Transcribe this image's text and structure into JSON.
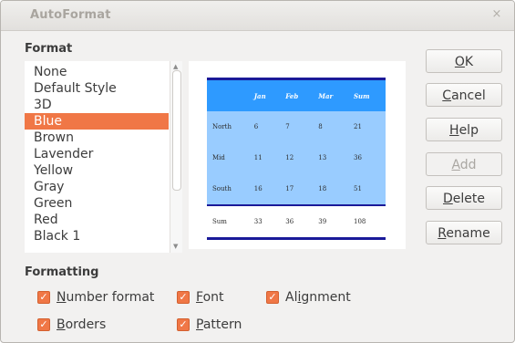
{
  "window": {
    "title": "AutoFormat",
    "close_icon": "close-icon"
  },
  "format": {
    "label": "Format",
    "items": [
      "None",
      "Default Style",
      "3D",
      "Blue",
      "Brown",
      "Lavender",
      "Yellow",
      "Gray",
      "Green",
      "Red",
      "Black 1"
    ],
    "selected": "Blue"
  },
  "preview": {
    "header": [
      "",
      "Jan",
      "Feb",
      "Mar",
      "Sum"
    ],
    "rows": [
      [
        "North",
        "6",
        "7",
        "8",
        "21"
      ],
      [
        "Mid",
        "11",
        "12",
        "13",
        "36"
      ],
      [
        "South",
        "16",
        "17",
        "18",
        "51"
      ]
    ],
    "sum": [
      "Sum",
      "33",
      "36",
      "39",
      "108"
    ],
    "colors": {
      "header_bg": "#2e9aff",
      "body_bg": "#99ccff",
      "border": "#1a1a99"
    }
  },
  "buttons": [
    {
      "prefix": "",
      "u": "O",
      "rest": "K"
    },
    {
      "prefix": "",
      "u": "C",
      "rest": "ancel"
    },
    {
      "prefix": "",
      "u": "H",
      "rest": "elp"
    },
    {
      "prefix": "",
      "u": "A",
      "rest": "dd"
    },
    {
      "prefix": "",
      "u": "D",
      "rest": "elete"
    },
    {
      "prefix": "",
      "u": "R",
      "rest": "ename"
    }
  ],
  "formatting": {
    "label": "Formatting",
    "options": [
      {
        "prefix": "",
        "u": "N",
        "rest": "umber format",
        "checked": true
      },
      {
        "prefix": "",
        "u": "F",
        "rest": "ont",
        "checked": true
      },
      {
        "prefix": "Al",
        "u": "i",
        "rest": "gnment",
        "checked": true
      },
      {
        "prefix": "",
        "u": "B",
        "rest": "orders",
        "checked": true
      },
      {
        "prefix": "",
        "u": "P",
        "rest": "attern",
        "checked": true
      }
    ]
  },
  "accent_color": "#f07746"
}
